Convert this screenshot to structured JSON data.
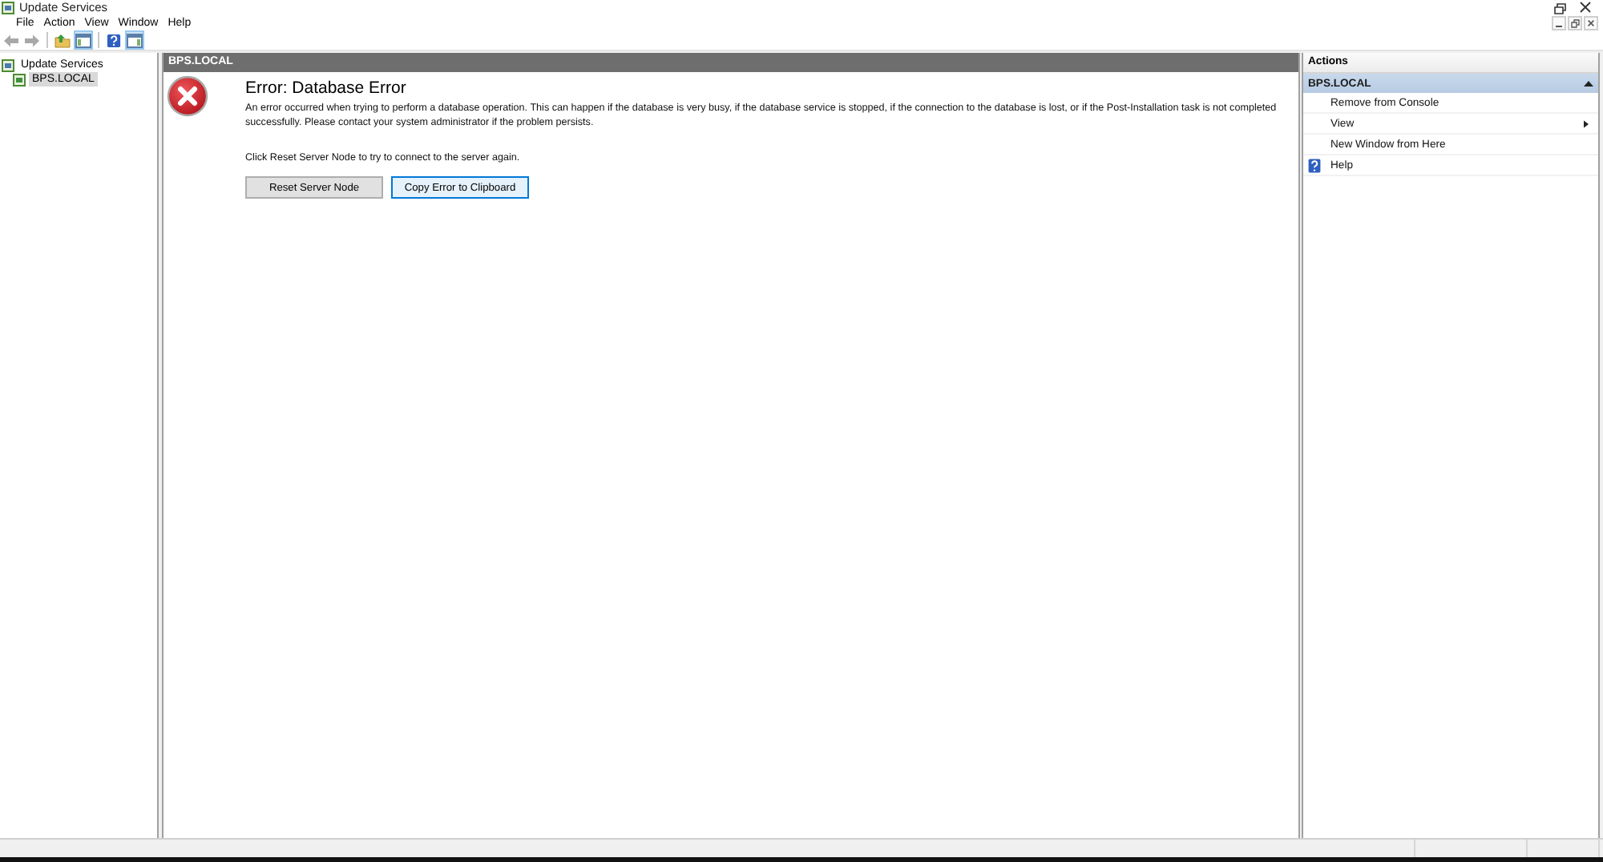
{
  "window": {
    "title": "Update Services"
  },
  "menu": [
    "File",
    "Action",
    "View",
    "Window",
    "Help"
  ],
  "toolbar": [
    {
      "buttons": [
        {
          "kind": "back",
          "disabled": true,
          "pressed": false
        },
        {
          "kind": "forward",
          "disabled": true,
          "pressed": false
        }
      ]
    },
    {
      "buttons": [
        {
          "kind": "up",
          "disabled": false,
          "pressed": false
        },
        {
          "kind": "tree",
          "disabled": false,
          "pressed": true
        }
      ]
    },
    {
      "buttons": [
        {
          "kind": "help",
          "disabled": false,
          "pressed": false
        },
        {
          "kind": "actions",
          "disabled": false,
          "pressed": true
        }
      ]
    }
  ],
  "tree": [
    {
      "label": "Update Services",
      "selected": false,
      "children": [
        {
          "label": "BPS.LOCAL",
          "selected": true
        }
      ]
    }
  ],
  "content": {
    "header": "BPS.LOCAL",
    "title": "Error: Database Error",
    "message": "An error occurred when trying to perform a database operation. This can happen if the database is very busy, if the database service is stopped, if the connection to the database is lost, or if the Post-Installation task is not completed successfully. Please contact your system administrator if the problem persists.",
    "hint": "Click Reset Server Node to try to connect to the server again.",
    "buttons": [
      {
        "label": "Reset Server Node",
        "focused": false
      },
      {
        "label": "Copy Error to Clipboard",
        "focused": true
      }
    ]
  },
  "actions": {
    "title": "Actions",
    "section": {
      "label": "BPS.LOCAL",
      "expanded": true
    },
    "items": [
      {
        "label": "Remove from Console",
        "kind": "plain"
      },
      {
        "label": "View",
        "kind": "submenu"
      },
      {
        "label": "New Window from Here",
        "kind": "plain"
      },
      {
        "label": "Help",
        "kind": "help"
      }
    ]
  }
}
